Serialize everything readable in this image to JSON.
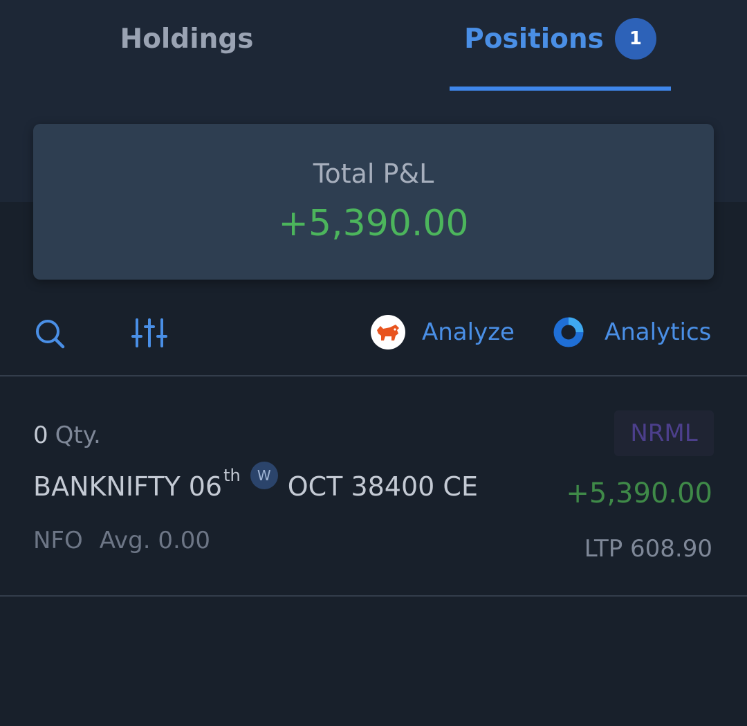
{
  "tabs": [
    {
      "label": "Holdings",
      "active": false
    },
    {
      "label": "Positions",
      "active": true,
      "badge": "1"
    }
  ],
  "summary": {
    "label": "Total P&L",
    "value": "+5,390.00"
  },
  "toolbar": {
    "search_icon": "search-icon",
    "filter_icon": "sliders-icon",
    "analyze_label": "Analyze",
    "analytics_label": "Analytics"
  },
  "positions": [
    {
      "qty": "0",
      "qty_unit": "Qty.",
      "product": "NRML",
      "symbol": "BANKNIFTY 06",
      "date_suffix": "th",
      "weekly_badge": "W",
      "contract": "OCT 38400 CE",
      "pnl": "+5,390.00",
      "exchange": "NFO",
      "avg": "Avg. 0.00",
      "ltp": "LTP 608.90"
    }
  ],
  "colors": {
    "background": "#18202b",
    "header_background": "#1d2736",
    "card_background": "#2e3e51",
    "accent": "#4a8fe6",
    "profit": "#4cb55c",
    "product_badge_text": "#4c3f8c"
  }
}
